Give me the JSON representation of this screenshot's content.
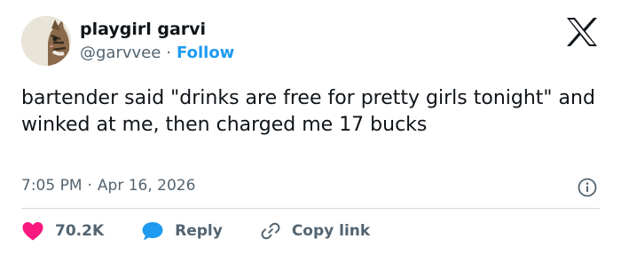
{
  "author": {
    "display_name": "playgirl garvi",
    "handle": "@garvvee",
    "separator": "·",
    "follow_label": "Follow",
    "avatar_icon": "cat-avatar"
  },
  "brand": {
    "logo_icon": "x-logo"
  },
  "tweet": {
    "text": "bartender said \"drinks are free for pretty girls tonight\" and winked at me, then charged me 17 bucks",
    "time": "7:05 PM",
    "separator": "·",
    "date": "Apr 16, 2026",
    "info_icon": "info-icon"
  },
  "actions": {
    "like_count": "70.2K",
    "reply_label": "Reply",
    "copy_link_label": "Copy link",
    "like_icon": "heart-icon",
    "reply_icon": "speech-bubble-icon",
    "copy_icon": "link-icon"
  },
  "colors": {
    "text_primary": "#0f1419",
    "text_secondary": "#536471",
    "accent_blue": "#1d9bf0",
    "like_red": "#f91880",
    "divider": "#cfd9de"
  }
}
